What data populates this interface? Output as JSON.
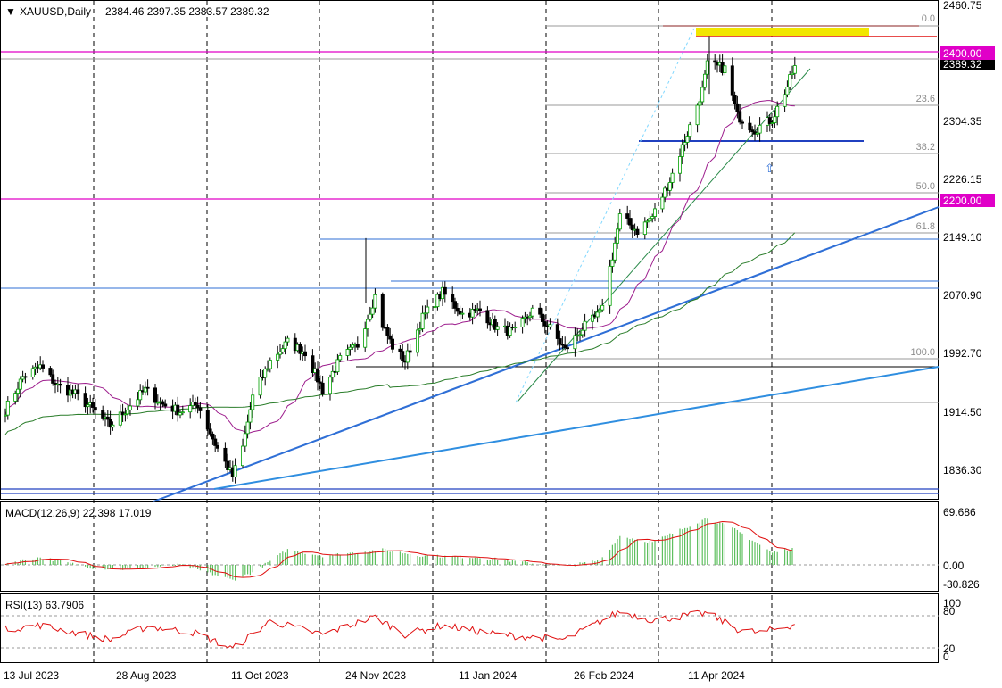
{
  "header": {
    "symbol": "XAUUSD,Daily",
    "ohlc": "2384.46 2397.35 2383.57 2389.32"
  },
  "price_axis": {
    "ticks": [
      "2460.75",
      "2304.35",
      "2226.15",
      "2149.10",
      "2070.90",
      "1992.70",
      "1914.50",
      "1836.30"
    ],
    "tag_2400": "2400.00",
    "tag_2200": "2200.00",
    "tag_current": "2389.32"
  },
  "fibo": {
    "levels": [
      "0.0",
      "23.6",
      "38.2",
      "50.0",
      "61.8",
      "100.0"
    ]
  },
  "macd": {
    "title": "MACD(12,26,9) 22.398 17.019",
    "ticks": [
      "69.686",
      "0.00",
      "-30.826"
    ]
  },
  "rsi": {
    "title": "RSI(13) 63.7906",
    "ticks": [
      "100",
      "80",
      "20",
      "0"
    ]
  },
  "time_axis": {
    "labels": [
      "13 Jul 2023",
      "28 Aug 2023",
      "11 Oct 2023",
      "24 Nov 2023",
      "11 Jan 2024",
      "26 Feb 2024",
      "11 Apr 2024"
    ]
  },
  "colors": {
    "bull": "#00a000",
    "bear": "#000000",
    "ma_purple": "#9e1f8e",
    "ma_green": "#2a7d2a",
    "trend_blue": "#2f6fd6",
    "magenta": "#e000c8",
    "red": "#e01010",
    "gold": "#f2e600",
    "macd_hist": "#5fbf5f",
    "signal": "#e01010"
  },
  "chart_data": {
    "type": "candlestick",
    "y_range": [
      1810,
      2470
    ],
    "first_date": "2023-07-06",
    "anchors": [
      [
        "2023-07-06",
        1912
      ],
      [
        "2023-07-13",
        1958
      ],
      [
        "2023-07-20",
        1972
      ],
      [
        "2023-07-27",
        1945
      ],
      [
        "2023-08-03",
        1934
      ],
      [
        "2023-08-10",
        1913
      ],
      [
        "2023-08-17",
        1890
      ],
      [
        "2023-08-24",
        1915
      ],
      [
        "2023-08-31",
        1940
      ],
      [
        "2023-09-07",
        1920
      ],
      [
        "2023-09-14",
        1910
      ],
      [
        "2023-09-21",
        1920
      ],
      [
        "2023-09-28",
        1865
      ],
      [
        "2023-10-05",
        1820
      ],
      [
        "2023-10-09",
        1860
      ],
      [
        "2023-10-13",
        1930
      ],
      [
        "2023-10-20",
        1980
      ],
      [
        "2023-10-27",
        2006
      ],
      [
        "2023-11-03",
        1992
      ],
      [
        "2023-11-10",
        1940
      ],
      [
        "2023-11-17",
        1982
      ],
      [
        "2023-11-24",
        2002
      ],
      [
        "2023-12-01",
        2070
      ],
      [
        "2023-12-04",
        2030
      ],
      [
        "2023-12-08",
        2000
      ],
      [
        "2023-12-13",
        1980
      ],
      [
        "2023-12-20",
        2040
      ],
      [
        "2023-12-28",
        2075
      ],
      [
        "2024-01-05",
        2045
      ],
      [
        "2024-01-12",
        2050
      ],
      [
        "2024-01-19",
        2025
      ],
      [
        "2024-01-26",
        2020
      ],
      [
        "2024-02-02",
        2050
      ],
      [
        "2024-02-09",
        2025
      ],
      [
        "2024-02-15",
        1995
      ],
      [
        "2024-02-22",
        2025
      ],
      [
        "2024-02-29",
        2045
      ],
      [
        "2024-03-05",
        2125
      ],
      [
        "2024-03-08",
        2180
      ],
      [
        "2024-03-15",
        2160
      ],
      [
        "2024-03-21",
        2180
      ],
      [
        "2024-03-28",
        2230
      ],
      [
        "2024-04-04",
        2295
      ],
      [
        "2024-04-10",
        2355
      ],
      [
        "2024-04-12",
        2390
      ],
      [
        "2024-04-19",
        2385
      ],
      [
        "2024-04-24",
        2320
      ],
      [
        "2024-05-01",
        2300
      ],
      [
        "2024-05-03",
        2305
      ],
      [
        "2024-05-08",
        2315
      ],
      [
        "2024-05-14",
        2360
      ],
      [
        "2024-05-17",
        2389
      ]
    ],
    "macd_anchors": [
      [
        "2023-07-06",
        2
      ],
      [
        "2023-07-20",
        10
      ],
      [
        "2023-08-10",
        -4
      ],
      [
        "2023-08-24",
        -6
      ],
      [
        "2023-09-14",
        0
      ],
      [
        "2023-10-05",
        -20
      ],
      [
        "2023-10-13",
        -10
      ],
      [
        "2023-10-27",
        20
      ],
      [
        "2023-11-10",
        12
      ],
      [
        "2023-12-04",
        20
      ],
      [
        "2023-12-20",
        12
      ],
      [
        "2024-01-12",
        10
      ],
      [
        "2024-02-02",
        2
      ],
      [
        "2024-02-15",
        -2
      ],
      [
        "2024-02-29",
        6
      ],
      [
        "2024-03-08",
        38
      ],
      [
        "2024-03-21",
        30
      ],
      [
        "2024-04-12",
        62
      ],
      [
        "2024-04-24",
        45
      ],
      [
        "2024-05-08",
        16
      ],
      [
        "2024-05-17",
        22.4
      ]
    ],
    "rsi_anchors": [
      [
        "2023-07-06",
        55
      ],
      [
        "2023-07-20",
        62
      ],
      [
        "2023-08-17",
        35
      ],
      [
        "2023-09-01",
        60
      ],
      [
        "2023-09-20",
        48
      ],
      [
        "2023-10-05",
        18
      ],
      [
        "2023-10-20",
        70
      ],
      [
        "2023-11-10",
        45
      ],
      [
        "2023-12-01",
        78
      ],
      [
        "2023-12-13",
        45
      ],
      [
        "2023-12-28",
        62
      ],
      [
        "2024-01-19",
        45
      ],
      [
        "2024-02-15",
        35
      ],
      [
        "2024-03-08",
        88
      ],
      [
        "2024-03-21",
        72
      ],
      [
        "2024-04-12",
        85
      ],
      [
        "2024-04-24",
        55
      ],
      [
        "2024-05-03",
        48
      ],
      [
        "2024-05-17",
        63.79
      ]
    ]
  }
}
